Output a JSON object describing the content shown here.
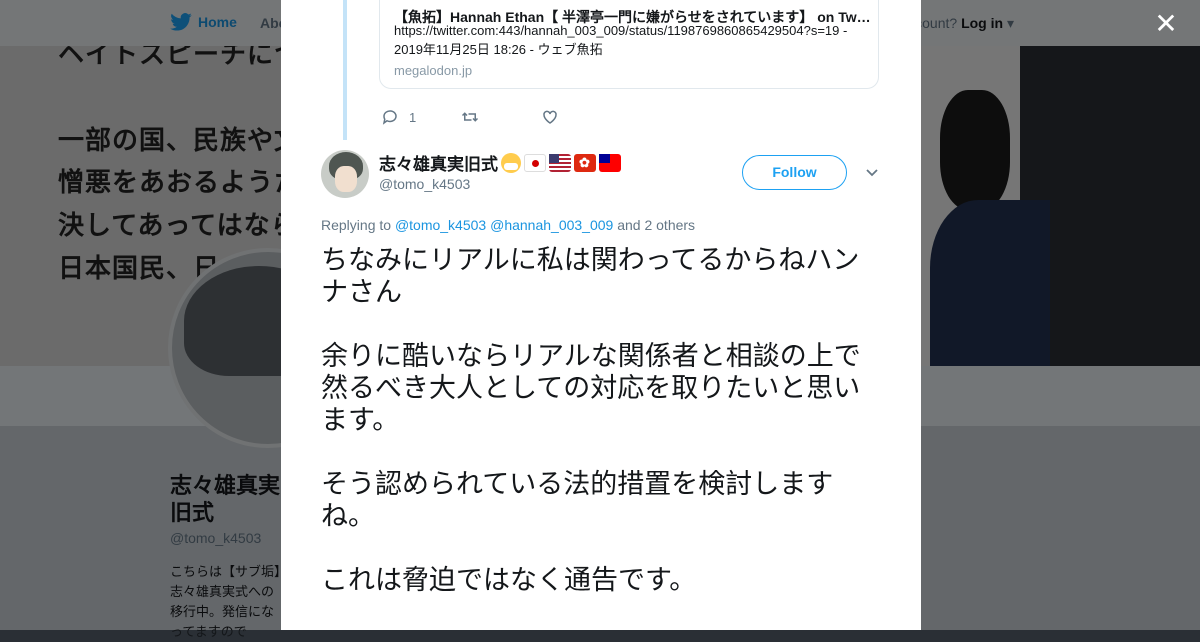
{
  "background": {
    "nav": {
      "home": "Home",
      "about": "Abo",
      "account_prompt": "ccount?",
      "login": "Log in"
    },
    "header_lines": [
      "ヘイトスピーチにつ",
      "一部の国、民族や文",
      "憎悪をあおるようた",
      "決してあってはなら",
      "日本国民、日"
    ],
    "profile": {
      "name": "志々雄真実旧式",
      "handle": "@tomo_k4503",
      "bio": "こちらは【サブ垢】志々雄真実式への移行中。発信になってますので"
    }
  },
  "modal": {
    "card": {
      "title": "【魚拓】Hannah Ethan【 半澤亭一門に嫌がらせをされています】 on Twitter",
      "description": "https://twitter.com:443/hannah_003_009/status/1198769860865429504?s=19 - 2019年11月25日 18:26 - ウェブ魚拓",
      "domain": "megalodon.jp"
    },
    "actions": {
      "reply_count": "1",
      "retweet_count": "",
      "like_count": ""
    },
    "tweet": {
      "display_name": "志々雄真実旧式",
      "handle": "@tomo_k4503",
      "follow_label": "Follow",
      "replying_prefix": "Replying to",
      "replying_to_1": "@tomo_k4503",
      "replying_to_2": "@hannah_003_009",
      "replying_suffix": "and 2 others",
      "paragraphs": [
        "ちなみにリアルに私は関わってるからねハンナさん",
        "余りに酷いならリアルな関係者と相談の上で然るべき大人としての対応を取りたいと思います。",
        "そう認められている法的措置を検討しますね。",
        "これは脅迫ではなく通告です。"
      ]
    },
    "icons": [
      "close-icon",
      "twitter-bird-icon",
      "reply-icon",
      "retweet-icon",
      "like-icon",
      "chevron-down-icon"
    ]
  }
}
